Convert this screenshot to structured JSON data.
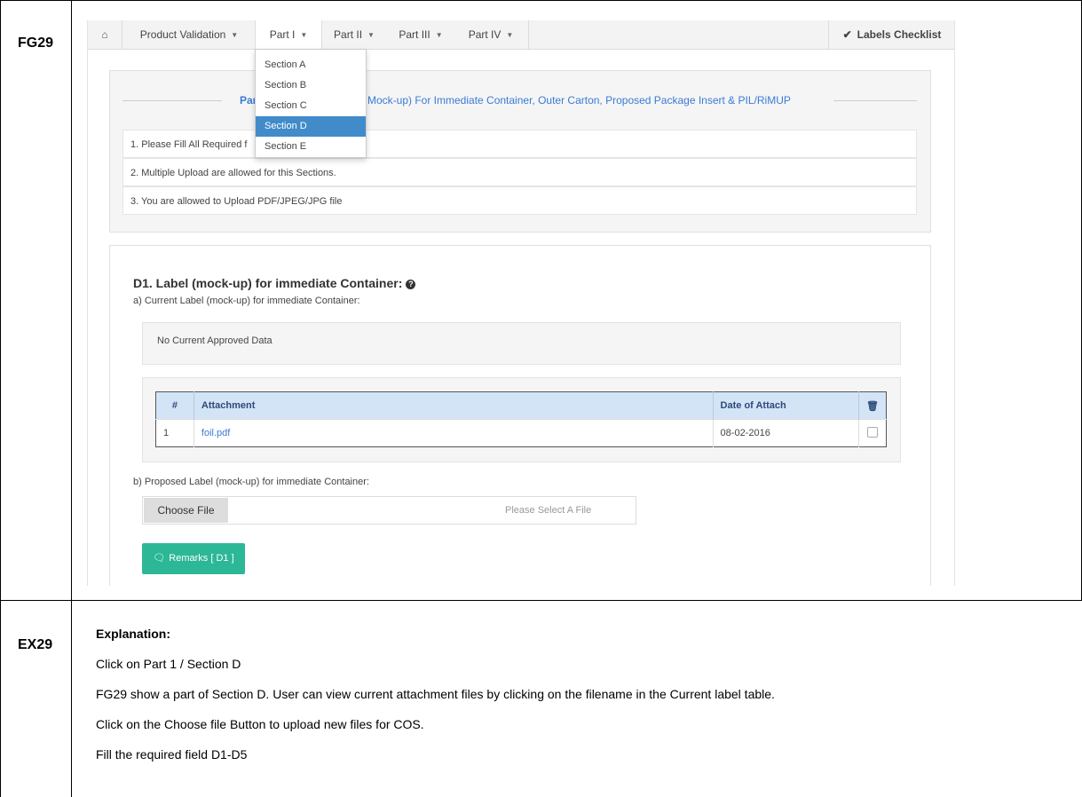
{
  "doc": {
    "row1_label": "FG29",
    "row2_label": "EX29",
    "explanation_heading": "Explanation:",
    "explanation_lines": [
      "Click on Part 1 / Section D",
      "FG29 show a part of Section D. User can view current attachment files by clicking on the filename in the Current label table.",
      "Click on the Choose file Button to upload new files for COS.",
      "Fill the required field D1-D5"
    ]
  },
  "nav": {
    "home_icon": "home-icon",
    "items": [
      "Product Validation",
      "Part I",
      "Part II",
      "Part III",
      "Part IV"
    ],
    "active_index": 1,
    "checklist_label": "Labels Checklist",
    "checklist_icon": "check-icon"
  },
  "dropdown": {
    "items": [
      "Section A",
      "Section B",
      "Section C",
      "Section D",
      "Section E"
    ],
    "active_index": 3
  },
  "info_panel": {
    "title_left": "Par",
    "title_right": "Mock-up) For Immediate Container, Outer Carton, Proposed Package Insert & PIL/RiMUP",
    "notes": [
      "1. Please Fill All Required f",
      "2. Multiple Upload are allowed for this Sections.",
      "3. You are allowed to Upload PDF/JPEG/JPG file"
    ]
  },
  "section_d1": {
    "title": "D1. Label (mock-up) for immediate Container:",
    "current_label": "a) Current Label (mock-up) for immediate Container:",
    "no_data": "No Current Approved Data",
    "table": {
      "headers": [
        "#",
        "Attachment",
        "Date of Attach"
      ],
      "rows": [
        {
          "num": "1",
          "file": "foil.pdf",
          "date": "08-02-2016"
        }
      ]
    },
    "proposed_label": "b) Proposed Label (mock-up) for immediate Container:",
    "choose_file": "Choose File",
    "file_placeholder": "Please Select A File",
    "remarks_button": "Remarks [ D1 ]"
  },
  "colors": {
    "accent": "#428bca",
    "link": "#3a7bd5",
    "remarks": "#2cb796",
    "table_header": "#d4e4f7"
  }
}
